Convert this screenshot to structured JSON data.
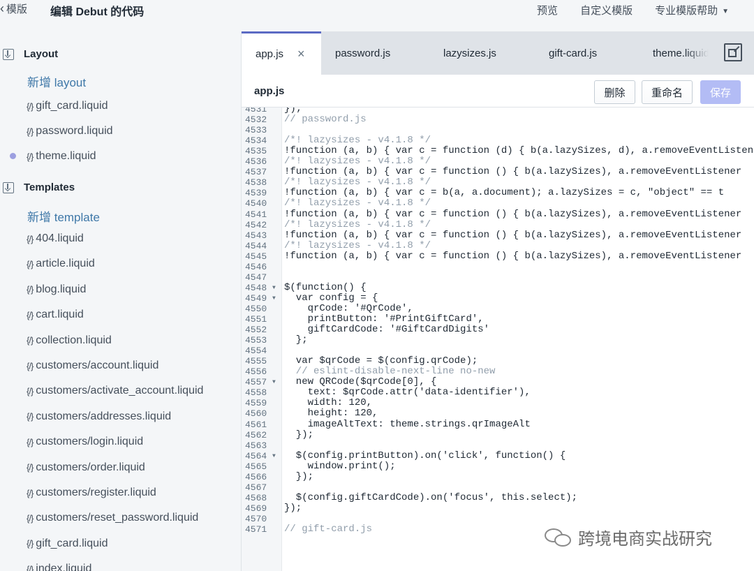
{
  "topbar": {
    "back_label": "模版",
    "title": "编辑 Debut 的代码",
    "preview": "预览",
    "customize": "自定义模版",
    "help": "专业模版帮助"
  },
  "sidebar": {
    "layout_header": "Layout",
    "layout_add": "新增 layout",
    "layout_files": [
      "gift_card.liquid",
      "password.liquid",
      "theme.liquid"
    ],
    "templates_header": "Templates",
    "templates_add": "新增 template",
    "template_files": [
      "404.liquid",
      "article.liquid",
      "blog.liquid",
      "cart.liquid",
      "collection.liquid",
      "customers/account.liquid",
      "customers/activate_account.liquid",
      "customers/addresses.liquid",
      "customers/login.liquid",
      "customers/order.liquid",
      "customers/register.liquid",
      "customers/reset_password.liquid",
      "gift_card.liquid",
      "index.liquid"
    ],
    "file_icon": "{/}"
  },
  "tabs": [
    {
      "label": "app.js",
      "active": true
    },
    {
      "label": "password.js"
    },
    {
      "label": "lazysizes.js"
    },
    {
      "label": "gift-card.js"
    },
    {
      "label": "theme.liquid"
    }
  ],
  "editor": {
    "file_name": "app.js",
    "delete_label": "删除",
    "rename_label": "重命名",
    "save_label": "保存"
  },
  "code_lines": [
    {
      "n": "4531",
      "t": "});"
    },
    {
      "n": "4532",
      "t": "// password.js",
      "c": "cm"
    },
    {
      "n": "4533",
      "t": ""
    },
    {
      "n": "4534",
      "t": "/*! lazysizes - v4.1.8 */",
      "c": "cm"
    },
    {
      "n": "4535",
      "t": "!function (a, b) { var c = function (d) { b(a.lazySizes, d), a.removeEventListener"
    },
    {
      "n": "4536",
      "t": "/*! lazysizes - v4.1.8 */",
      "c": "cm"
    },
    {
      "n": "4537",
      "t": "!function (a, b) { var c = function () { b(a.lazySizes), a.removeEventListener"
    },
    {
      "n": "4538",
      "t": "/*! lazysizes - v4.1.8 */",
      "c": "cm"
    },
    {
      "n": "4539",
      "t": "!function (a, b) { var c = b(a, a.document); a.lazySizes = c, \"object\" == t"
    },
    {
      "n": "4540",
      "t": "/*! lazysizes - v4.1.8 */",
      "c": "cm"
    },
    {
      "n": "4541",
      "t": "!function (a, b) { var c = function () { b(a.lazySizes), a.removeEventListener"
    },
    {
      "n": "4542",
      "t": "/*! lazysizes - v4.1.8 */",
      "c": "cm"
    },
    {
      "n": "4543",
      "t": "!function (a, b) { var c = function () { b(a.lazySizes), a.removeEventListener"
    },
    {
      "n": "4544",
      "t": "/*! lazysizes - v4.1.8 */",
      "c": "cm"
    },
    {
      "n": "4545",
      "t": "!function (a, b) { var c = function () { b(a.lazySizes), a.removeEventListener"
    },
    {
      "n": "4546",
      "t": ""
    },
    {
      "n": "4547",
      "t": ""
    },
    {
      "n": "4548",
      "t": "$(function() {",
      "fold": true
    },
    {
      "n": "4549",
      "t": "  var config = {",
      "fold": true
    },
    {
      "n": "4550",
      "t": "    qrCode: '#QrCode',"
    },
    {
      "n": "4551",
      "t": "    printButton: '#PrintGiftCard',"
    },
    {
      "n": "4552",
      "t": "    giftCardCode: '#GiftCardDigits'"
    },
    {
      "n": "4553",
      "t": "  };"
    },
    {
      "n": "4554",
      "t": ""
    },
    {
      "n": "4555",
      "t": "  var $qrCode = $(config.qrCode);"
    },
    {
      "n": "4556",
      "t": "  // eslint-disable-next-line no-new",
      "c": "cm"
    },
    {
      "n": "4557",
      "t": "  new QRCode($qrCode[0], {",
      "fold": true
    },
    {
      "n": "4558",
      "t": "    text: $qrCode.attr('data-identifier'),"
    },
    {
      "n": "4559",
      "t": "    width: 120,"
    },
    {
      "n": "4560",
      "t": "    height: 120,"
    },
    {
      "n": "4561",
      "t": "    imageAltText: theme.strings.qrImageAlt"
    },
    {
      "n": "4562",
      "t": "  });"
    },
    {
      "n": "4563",
      "t": ""
    },
    {
      "n": "4564",
      "t": "  $(config.printButton).on('click', function() {",
      "fold": true
    },
    {
      "n": "4565",
      "t": "    window.print();"
    },
    {
      "n": "4566",
      "t": "  });"
    },
    {
      "n": "4567",
      "t": ""
    },
    {
      "n": "4568",
      "t": "  $(config.giftCardCode).on('focus', this.select);"
    },
    {
      "n": "4569",
      "t": "});"
    },
    {
      "n": "4570",
      "t": ""
    },
    {
      "n": "4571",
      "t": "// gift-card.js",
      "c": "cm"
    }
  ],
  "watermark": "跨境电商实战研究",
  "colors": {
    "accent": "#5c6ac4",
    "link": "#3f78a8",
    "save_disabled": "#b3bcf5",
    "theme_dot": "#9c9fe0"
  }
}
